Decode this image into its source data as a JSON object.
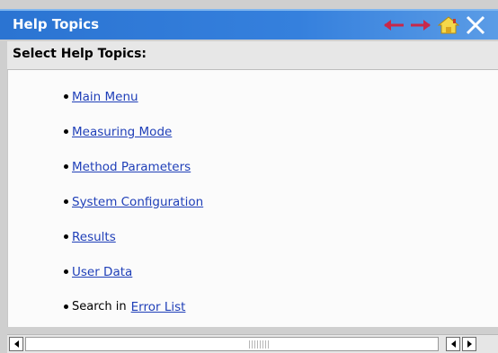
{
  "window": {
    "title": "Help Topics"
  },
  "toolbar": {
    "icons": [
      "back-arrow-icon",
      "forward-arrow-icon",
      "home-icon",
      "close-icon"
    ],
    "colors": {
      "arrow": "#c8284a",
      "home": "#f5d84a",
      "close": "#ffffff"
    }
  },
  "header": {
    "label": "Select Help Topics:"
  },
  "topics": [
    {
      "prefix": "",
      "label": "Main Menu"
    },
    {
      "prefix": "",
      "label": "Measuring Mode"
    },
    {
      "prefix": "",
      "label": "Method Parameters"
    },
    {
      "prefix": "",
      "label": "System Configuration"
    },
    {
      "prefix": "",
      "label": "Results"
    },
    {
      "prefix": "",
      "label": "User Data"
    },
    {
      "prefix": "Search in",
      "label": "Error List"
    }
  ],
  "colors": {
    "titlebar": "#2f7ad8",
    "link": "#1f3fb8",
    "background": "#bfe3f7"
  }
}
